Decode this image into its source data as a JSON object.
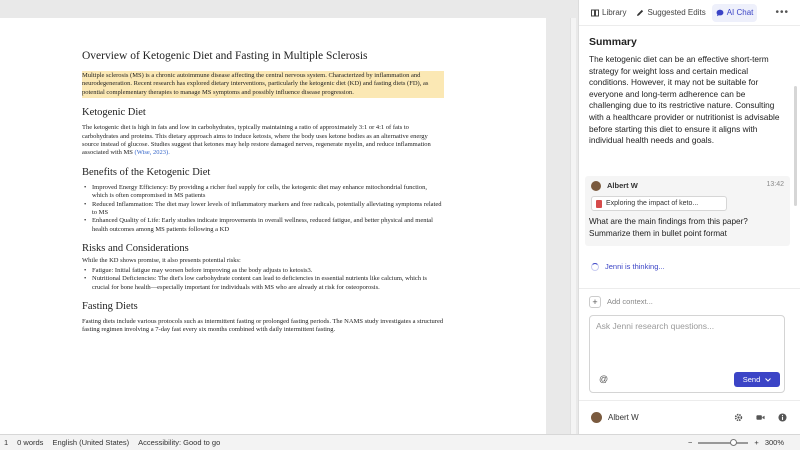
{
  "document": {
    "title": "Overview of Ketogenic Diet and Fasting in Multiple Sclerosis",
    "intro": "Multiple sclerosis (MS) is a chronic autoimmune disease affecting the central nervous system. Characterized by inflammation and neurodegeneration. Recent research has explored dietary interventions, particularly the ketogenic diet (KD) and fasting diets (FD), as potential complementary therapies to manage MS symptoms and possibly influence disease progression.",
    "sections": {
      "keto_heading": "Ketogenic Diet",
      "keto_text": "The ketogenic diet is high in fats and low in carbohydrates, typically maintaining a ratio of approximately 3:1 or 4:1 of fats to carbohydrates and proteins. This dietary approach aims to induce ketosis, where the body uses ketone bodies as an alternative energy source instead of glucose. Studies suggest that ketones may help restore damaged nerves, regenerate myelin, and reduce inflammation associated with MS",
      "keto_cite": "(Wise, 2023).",
      "benefits_heading": "Benefits of the Ketogenic Diet",
      "benefits": [
        "Improved Energy Efficiency: By providing a richer fuel supply for cells, the ketogenic diet may enhance mitochondrial function, which is often compromised in MS patients",
        "Reduced Inflammation: The diet may lower levels of inflammatory markers and free radicals, potentially alleviating symptoms related to MS",
        "Enhanced Quality of Life: Early studies indicate improvements in overall wellness, reduced fatigue, and better physical and mental health outcomes among MS patients following a KD"
      ],
      "risks_heading": "Risks and Considerations",
      "risks_intro": "While the KD shows promise, it also presents potential risks:",
      "risks": [
        "Fatigue: Initial fatigue may worsen before improving as the body adjusts to ketosis3.",
        "Nutritional Deficiencies: The diet's low carbohydrate content can lead to deficiencies in essential nutrients like calcium, which is crucial for bone health—especially important for individuals with MS who are already at risk for osteoporosis."
      ],
      "fasting_heading": "Fasting Diets",
      "fasting_text": "Fasting diets include various protocols such as intermittent fasting or prolonged fasting periods. The NAMS study investigates a structured fasting regimen involving a 7-day fast every six months combined with daily intermittent fasting."
    }
  },
  "panel": {
    "tabs": [
      {
        "label": "Library",
        "icon": "library-icon"
      },
      {
        "label": "Suggested Edits",
        "icon": "pencil-icon"
      },
      {
        "label": "AI Chat",
        "icon": "chat-icon",
        "active": true
      }
    ],
    "more": "•••",
    "summary_title": "Summary",
    "summary_text": "The ketogenic diet can be an effective short-term strategy for weight loss and certain medical conditions. However, it may not be suitable for everyone and long-term adherence can be challenging due to its restrictive nature. Consulting with a healthcare provider or nutritionist is advisable before starting this diet to ensure it aligns with individual health needs and goals.",
    "message": {
      "author": "Albert W",
      "time": "13:42",
      "attachment": "Exploring the impact of keto...",
      "text": "What are the main findings from this paper? Summarize them in bullet point format"
    },
    "thinking": "Jenni is thinking...",
    "add_context": "Add context...",
    "input_placeholder": "Ask Jenni research questions...",
    "at_symbol": "@",
    "send_label": "Send",
    "footer_user": "Albert W"
  },
  "statusbar": {
    "page": "1",
    "words": "0 words",
    "language": "English (United States)",
    "accessibility": "Accessibility: Good to go",
    "zoom_out": "−",
    "zoom_in": "+",
    "zoom": "300%",
    "zoom_level_percent": 300
  },
  "colors": {
    "accent": "#3b44c6",
    "highlight": "#fbe8b4",
    "citation": "#3566c9"
  }
}
